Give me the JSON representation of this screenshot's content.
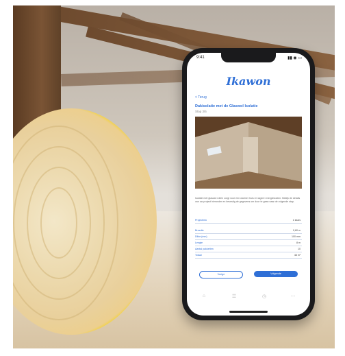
{
  "status": {
    "time": "9:41",
    "indicators": "▮▮ ◉ ▭"
  },
  "app": {
    "logo_text": "Ikawon"
  },
  "nav": {
    "back_label": "< Terug"
  },
  "content": {
    "title": "Dakisolatie met de Glaswol Isolatie",
    "subtitle": "Stap 3/5",
    "description": "Isolatie met glaswol rollen zorgt voor een warmer huis en lagere energiekosten. Bekijk de details van uw project hieronder en bevestig de gegevens om door te gaan naar de volgende stap.",
    "summary_label": "Projectinfo",
    "summary_value": "1 stuks"
  },
  "details": [
    {
      "label": "Breedte",
      "value": "0,60 m"
    },
    {
      "label": "Dikte (mm)",
      "value": "100 mm"
    },
    {
      "label": "Lengte",
      "value": "8 m"
    },
    {
      "label": "Aantal pakketten",
      "value": "10"
    },
    {
      "label": "Totaal",
      "value": "48 m²"
    }
  ],
  "buttons": {
    "secondary": "Vorige",
    "primary": "Volgende"
  },
  "tabs": [
    "⌂",
    "☰",
    "◷",
    "⋯"
  ],
  "colors": {
    "accent": "#2f6fd6",
    "roll_yellow": "#f0c928"
  }
}
